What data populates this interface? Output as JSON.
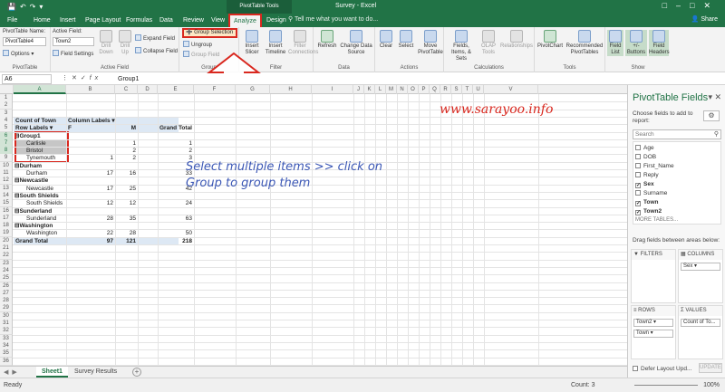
{
  "window": {
    "title": "Survey - Excel",
    "context_label": "PivotTable Tools",
    "share": "Share",
    "tell_me": "Tell me what you want to do..."
  },
  "tabs": [
    {
      "label": "File"
    },
    {
      "label": "Home"
    },
    {
      "label": "Insert"
    },
    {
      "label": "Page Layout"
    },
    {
      "label": "Formulas"
    },
    {
      "label": "Data"
    },
    {
      "label": "Review"
    },
    {
      "label": "View"
    },
    {
      "label": "Analyze",
      "active": true
    },
    {
      "label": "Design"
    }
  ],
  "ribbon": {
    "pivottable": {
      "name_label": "PivotTable Name:",
      "name_value": "PivotTable4",
      "options": "Options",
      "group_label": "PivotTable"
    },
    "active_field": {
      "label": "Active Field:",
      "value": "Town2",
      "field_settings": "Field Settings",
      "drill_down": "Drill Down",
      "drill_up": "Drill Up",
      "expand": "Expand Field",
      "collapse": "Collapse Field",
      "group_label": "Active Field"
    },
    "group": {
      "group_selection": "Group Selection",
      "ungroup": "Ungroup",
      "group_field": "Group Field",
      "group_label": "Group"
    },
    "filter": {
      "insert_slicer": "Insert Slicer",
      "insert_timeline": "Insert Timeline",
      "filter_connections": "Filter Connections",
      "group_label": "Filter"
    },
    "data": {
      "refresh": "Refresh",
      "change_source": "Change Data Source",
      "group_label": "Data"
    },
    "actions": {
      "clear": "Clear",
      "select": "Select",
      "move": "Move PivotTable",
      "group_label": "Actions"
    },
    "calculations": {
      "fields_items": "Fields, Items, & Sets",
      "olap": "OLAP Tools",
      "relationships": "Relationships",
      "group_label": "Calculations"
    },
    "tools": {
      "pivotchart": "PivotChart",
      "recommended": "Recommended PivotTables",
      "group_label": "Tools"
    },
    "show": {
      "field_list": "Field List",
      "buttons": "+/- Buttons",
      "headers": "Field Headers",
      "group_label": "Show"
    }
  },
  "formula_bar": {
    "name_box": "A6",
    "fx": "fx",
    "content": "Group1"
  },
  "columns": [
    "A",
    "B",
    "C",
    "D",
    "E",
    "F",
    "G",
    "H",
    "I",
    "J",
    "K",
    "L",
    "M",
    "N",
    "O",
    "P",
    "Q",
    "R",
    "S",
    "T",
    "U",
    "V"
  ],
  "rows": [
    "1",
    "2",
    "3",
    "4",
    "5",
    "6",
    "7",
    "8",
    "9",
    "10",
    "11",
    "12",
    "13",
    "14",
    "15",
    "16",
    "17",
    "18",
    "19",
    "20",
    "21",
    "22",
    "23",
    "24",
    "25",
    "26",
    "27",
    "28",
    "29",
    "30",
    "31",
    "32",
    "33",
    "34",
    "35",
    "36"
  ],
  "pivot": {
    "header_count": "Count of Town",
    "header_col_labels": "Column Labels",
    "row_labels": "Row Labels",
    "col_f": "F",
    "col_m": "M",
    "col_total": "Grand Total",
    "body": [
      {
        "label": "Group1",
        "f": "",
        "m": "",
        "t": "",
        "level": 0
      },
      {
        "label": "Carlisle",
        "f": "",
        "m": "1",
        "t": "1",
        "level": 1
      },
      {
        "label": "Bristol",
        "f": "",
        "m": "2",
        "t": "2",
        "level": 1
      },
      {
        "label": "Tynemouth",
        "f": "1",
        "m": "2",
        "t": "3",
        "level": 1
      },
      {
        "label": "Durham",
        "f": "",
        "m": "",
        "t": "",
        "level": 0
      },
      {
        "label": "Durham",
        "f": "17",
        "m": "16",
        "t": "33",
        "level": 1
      },
      {
        "label": "Newcastle",
        "f": "",
        "m": "",
        "t": "",
        "level": 0
      },
      {
        "label": "Newcastle",
        "f": "17",
        "m": "25",
        "t": "42",
        "level": 1
      },
      {
        "label": "South Shields",
        "f": "",
        "m": "",
        "t": "",
        "level": 0
      },
      {
        "label": "South Shields",
        "f": "12",
        "m": "12",
        "t": "24",
        "level": 1
      },
      {
        "label": "Sunderland",
        "f": "",
        "m": "",
        "t": "",
        "level": 0
      },
      {
        "label": "Sunderland",
        "f": "28",
        "m": "35",
        "t": "63",
        "level": 1
      },
      {
        "label": "Washington",
        "f": "",
        "m": "",
        "t": "",
        "level": 0
      },
      {
        "label": "Washington",
        "f": "22",
        "m": "28",
        "t": "50",
        "level": 1
      }
    ],
    "grand_total": {
      "label": "Grand Total",
      "f": "97",
      "m": "121",
      "t": "218"
    }
  },
  "overlay": {
    "watermark": "www.sarayoo.info",
    "annotation": "Select multiple items >> click on Group to group them"
  },
  "sheets": [
    {
      "label": "Sheet1",
      "active": true
    },
    {
      "label": "Survey Results"
    }
  ],
  "status": {
    "ready": "Ready",
    "count": "Count: 3",
    "zoom": "100%"
  },
  "field_pane": {
    "title": "PivotTable Fields",
    "hint": "Choose fields to add to report:",
    "search_placeholder": "Search",
    "fields": [
      {
        "name": "Age",
        "checked": false
      },
      {
        "name": "DOB",
        "checked": false
      },
      {
        "name": "First_Name",
        "checked": false
      },
      {
        "name": "Reply",
        "checked": false
      },
      {
        "name": "Sex",
        "checked": true
      },
      {
        "name": "Surname",
        "checked": false
      },
      {
        "name": "Town",
        "checked": true
      },
      {
        "name": "Town2",
        "checked": true
      },
      {
        "name": "MORE TABLES...",
        "checked": false
      }
    ],
    "drag_hint": "Drag fields between areas below:",
    "areas": {
      "filters": {
        "label": "FILTERS",
        "items": []
      },
      "columns": {
        "label": "COLUMNS",
        "items": [
          "Sex"
        ]
      },
      "rows": {
        "label": "ROWS",
        "items": [
          "Town2",
          "Town"
        ]
      },
      "values": {
        "label": "VALUES",
        "items": [
          "Count of To..."
        ]
      }
    },
    "defer": "Defer Layout Upd...",
    "update": "UPDATE"
  },
  "colors": {
    "excel_green": "#217346",
    "highlight_red": "#d9281f",
    "annotation_blue": "#3b57b5"
  }
}
